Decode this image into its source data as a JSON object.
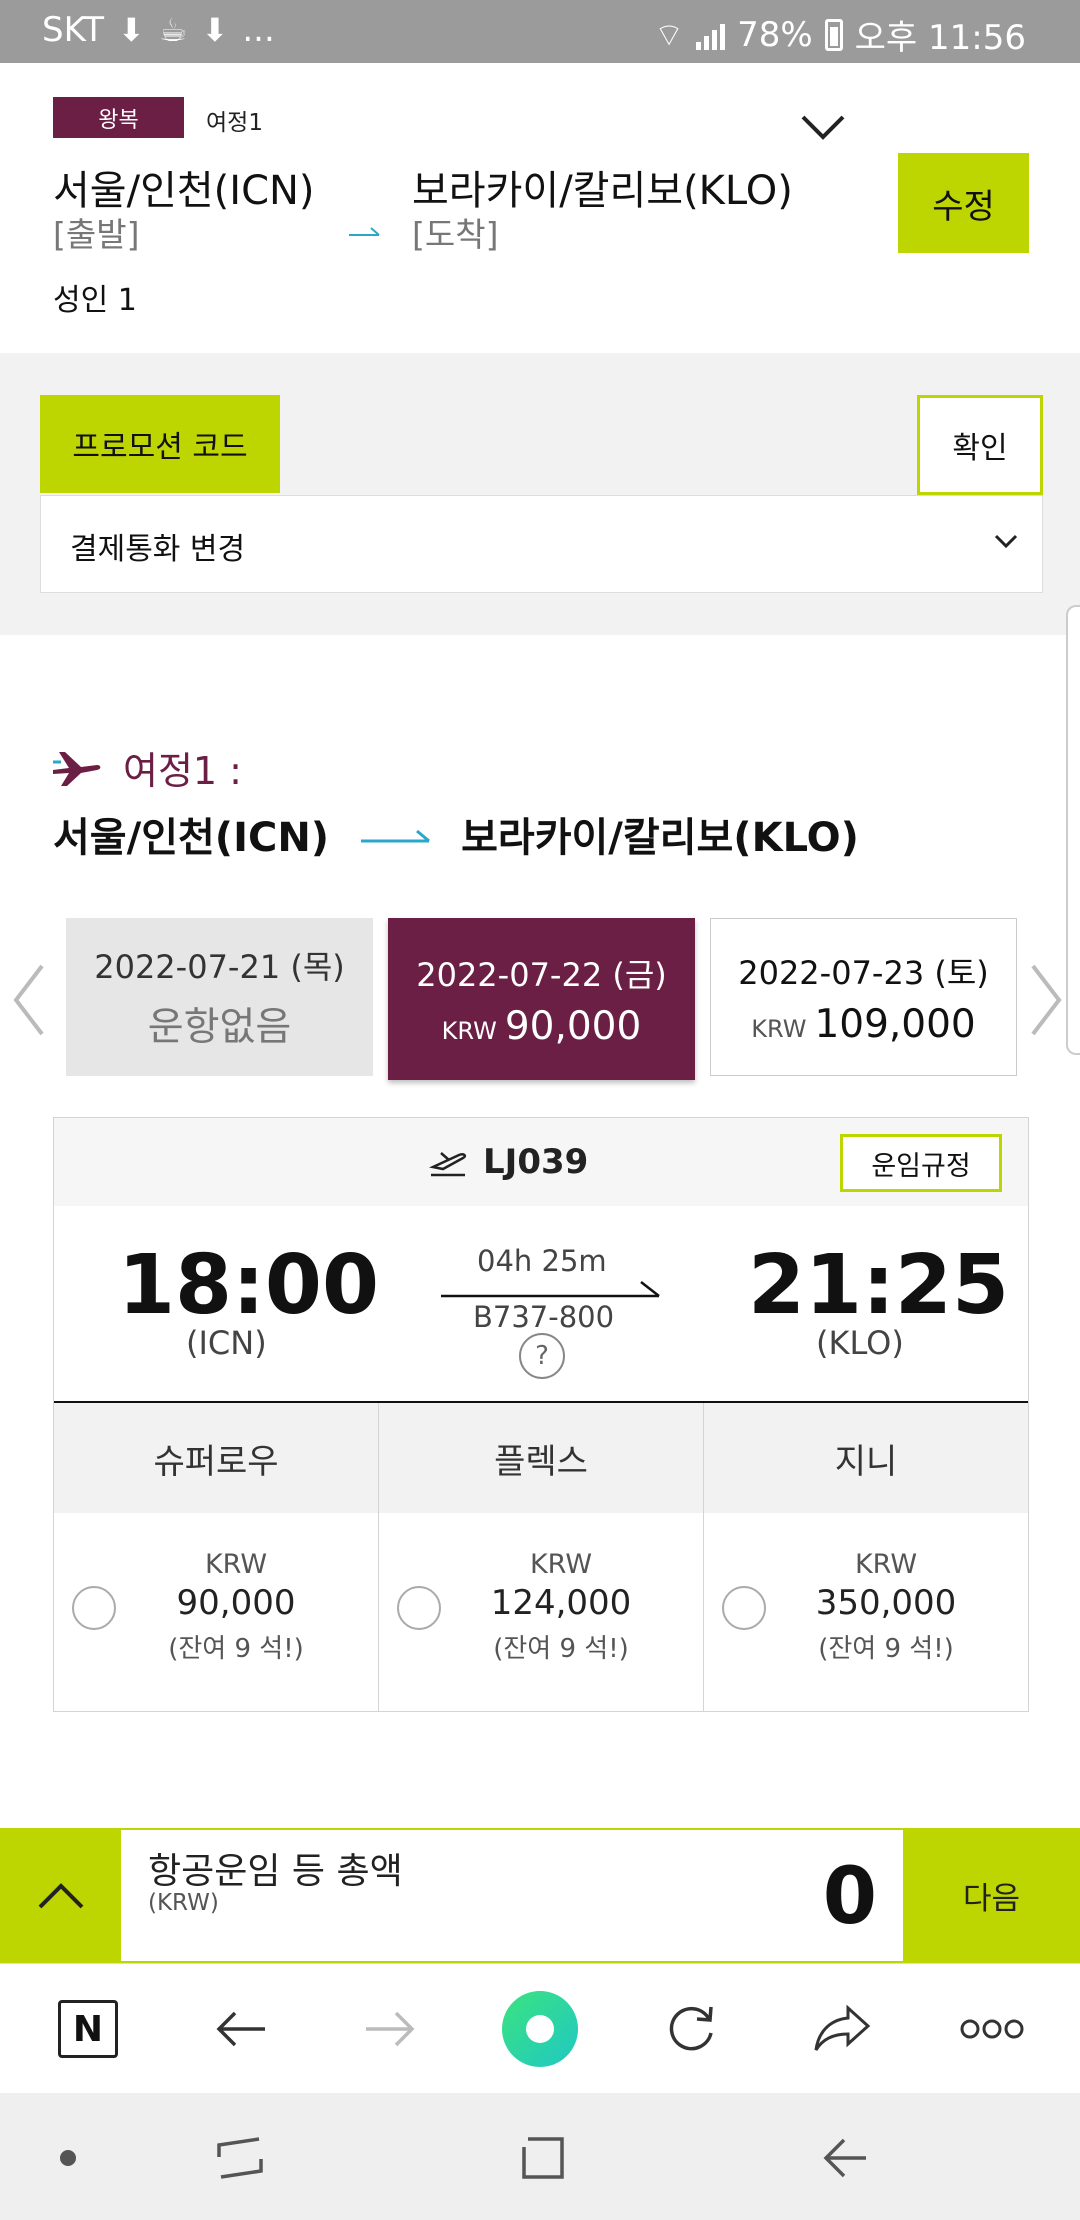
{
  "status_bar": {
    "carrier": "SKT",
    "extra": "...",
    "battery": "78%",
    "time": "오후 11:56"
  },
  "trip": {
    "badge": "왕복",
    "leg_label": "여정1",
    "departure_city": "서울/인천(ICN)",
    "departure_sub": "[출발]",
    "arrival_city": "보라카이/칼리보(KLO)",
    "arrival_sub": "[도착]",
    "passengers": "성인 1",
    "edit_label": "수정"
  },
  "promo": {
    "tab_label": "프로모션 코드",
    "confirm_label": "확인",
    "currency_label": "결제통화 변경"
  },
  "itinerary": {
    "title": "여정1 :",
    "from": "서울/인천(ICN)",
    "to": "보라카이/칼리보(KLO)"
  },
  "dates": [
    {
      "date": "2022-07-21 (목)",
      "status": "운항없음"
    },
    {
      "date": "2022-07-22 (금)",
      "currency": "KRW",
      "price": "90,000"
    },
    {
      "date": "2022-07-23 (토)",
      "currency": "KRW",
      "price": "109,000"
    }
  ],
  "flight": {
    "number": "LJ039",
    "fare_rule_label": "운임규정",
    "dep_time": "18:00",
    "dep_airport": "(ICN)",
    "arr_time": "21:25",
    "arr_airport": "(KLO)",
    "duration": "04h 25m",
    "aircraft": "B737-800",
    "help": "?",
    "fares": [
      {
        "name": "슈퍼로우",
        "currency": "KRW",
        "amount": "90,000",
        "seats": "(잔여 9 석!)"
      },
      {
        "name": "플렉스",
        "currency": "KRW",
        "amount": "124,000",
        "seats": "(잔여 9 석!)"
      },
      {
        "name": "지니",
        "currency": "KRW",
        "amount": "350,000",
        "seats": "(잔여 9 석!)"
      }
    ]
  },
  "total": {
    "label": "항공운임 등 총액",
    "currency": "(KRW)",
    "amount": "0",
    "next_label": "다음"
  },
  "browser": {
    "home_letter": "N"
  },
  "colors": {
    "accent_lime": "#bdd500",
    "brand_plum": "#6b1f45",
    "route_arrow": "#2aa7c9"
  }
}
